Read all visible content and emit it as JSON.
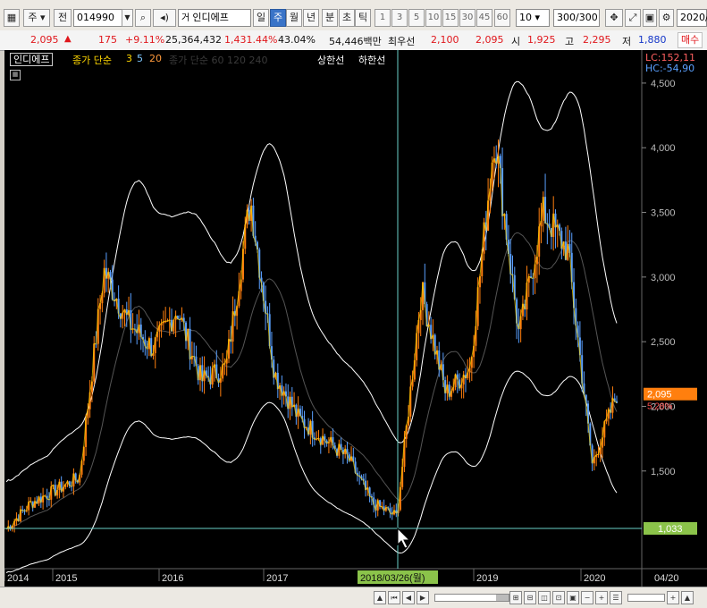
{
  "toolbar": {
    "market": "주",
    "type_label": "전",
    "stock_code": "014990",
    "stock_name": "인디에프",
    "periods": [
      "일",
      "주",
      "월",
      "년",
      "분",
      "초",
      "틱"
    ],
    "active_period": "주",
    "intervals": [
      "1",
      "3",
      "5",
      "10",
      "15",
      "30",
      "45",
      "60"
    ],
    "interval_select": "10",
    "count": "300/300",
    "date": "2020/"
  },
  "quote": {
    "price": "2,095",
    "arrow": "▲",
    "change": "175",
    "change_pct": "+9.11%",
    "volume": "25,364,432",
    "volume_pct": "1,431.44%",
    "turnover": "43.04%",
    "amount": "54,446백만",
    "best_bid_label": "최우선",
    "best_bid": "2,100",
    "best_ask": "2,095",
    "open_label": "시",
    "open": "1,925",
    "high_label": "고",
    "high": "2,295",
    "low_label": "저",
    "low": "1,880",
    "buy_label": "매수"
  },
  "legend": {
    "name": "인디에프",
    "ma_label": "종가 단순",
    "ma_values": [
      "3",
      "5",
      "20"
    ],
    "hidden_label": "종가 단순 60 120 240",
    "upper": "상한선",
    "lower": "하한선"
  },
  "axis": {
    "lc": "LC:152,11",
    "hc": "HC:-54,90",
    "y_ticks": [
      "4,500",
      "4,000",
      "3,500",
      "3,000",
      "2,500",
      "2,000",
      "1,500"
    ],
    "x_ticks": [
      "2014",
      "2015",
      "2016",
      "2017",
      "2019",
      "2020"
    ],
    "cursor_date": "2018/03/26(월)",
    "end_label": "04/20",
    "current_price": "2,095",
    "current_pct": "5.28%",
    "cursor_price": "1,033"
  },
  "chart_data": {
    "type": "candlestick",
    "x": [
      "2014-01",
      "2014-04",
      "2014-07",
      "2014-10",
      "2015-01",
      "2015-04",
      "2015-07",
      "2015-10",
      "2016-01",
      "2016-04",
      "2016-07",
      "2016-10",
      "2017-01",
      "2017-04",
      "2017-07",
      "2017-10",
      "2018-01",
      "2018-04",
      "2018-07",
      "2018-10",
      "2019-01",
      "2019-04",
      "2019-07",
      "2019-10",
      "2020-01",
      "2020-04"
    ],
    "close": [
      1050,
      1250,
      1350,
      1450,
      3050,
      2650,
      2450,
      2750,
      2200,
      2300,
      3600,
      2250,
      1900,
      1750,
      1600,
      1250,
      1150,
      2900,
      2100,
      2300,
      4100,
      2550,
      3500,
      3200,
      1550,
      2095
    ],
    "ylim": [
      800,
      4700
    ],
    "colors": {
      "up": "#ff7f0e",
      "down": "#5aa0ff",
      "price_line": "#ffd700",
      "ma": "#ffffff"
    }
  }
}
